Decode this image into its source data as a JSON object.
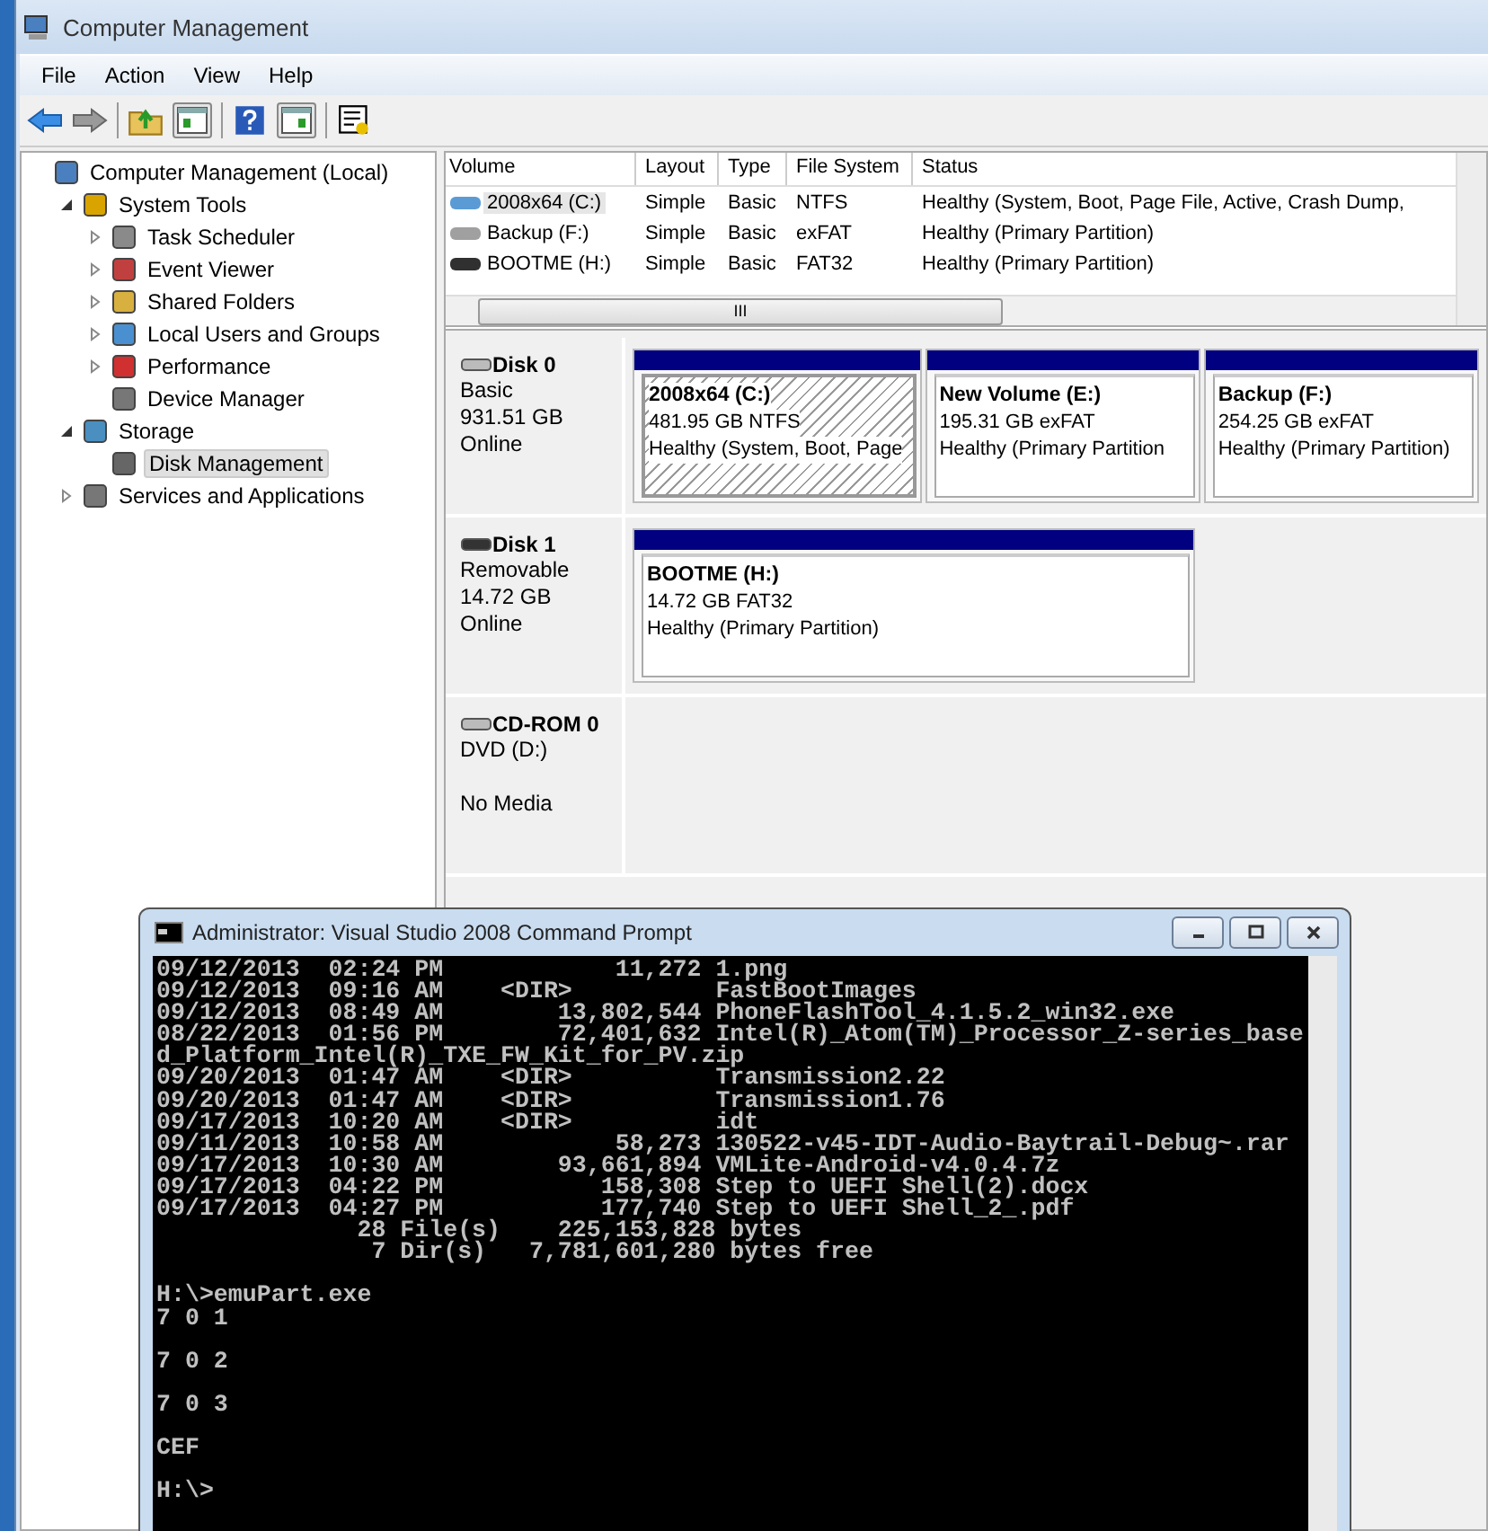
{
  "window": {
    "title": "Computer Management"
  },
  "menu": [
    "File",
    "Action",
    "View",
    "Help"
  ],
  "tree": [
    {
      "label": "Computer Management (Local)",
      "selected": false,
      "children": [
        {
          "label": "System Tools",
          "expanded": true,
          "selected": false,
          "children": [
            {
              "label": "Task Scheduler",
              "expanded": false,
              "selected": false
            },
            {
              "label": "Event Viewer",
              "expanded": false,
              "selected": false
            },
            {
              "label": "Shared Folders",
              "expanded": false,
              "selected": false
            },
            {
              "label": "Local Users and Groups",
              "expanded": false,
              "selected": false
            },
            {
              "label": "Performance",
              "expanded": false,
              "selected": false
            },
            {
              "label": "Device Manager",
              "selected": false
            }
          ]
        },
        {
          "label": "Storage",
          "expanded": true,
          "selected": false,
          "children": [
            {
              "label": "Disk Management",
              "selected": true
            }
          ]
        },
        {
          "label": "Services and Applications",
          "expanded": false,
          "selected": false
        }
      ]
    }
  ],
  "table": {
    "columns": [
      "Volume",
      "Layout",
      "Type",
      "File System",
      "Status"
    ],
    "rows": [
      {
        "volume": "2008x64 (C:)",
        "layout": "Simple",
        "type": "Basic",
        "file_system": "NTFS",
        "status": "Healthy (System, Boot, Page File, Active, Crash Dump,",
        "selected": true,
        "color": "#5b9bd5"
      },
      {
        "volume": "Backup (F:)",
        "layout": "Simple",
        "type": "Basic",
        "file_system": "exFAT",
        "status": "Healthy (Primary Partition)",
        "selected": false,
        "color": "#a0a0a0"
      },
      {
        "volume": "BOOTME (H:)",
        "layout": "Simple",
        "type": "Basic",
        "file_system": "FAT32",
        "status": "Healthy (Primary Partition)",
        "selected": false,
        "color": "#303030"
      }
    ],
    "scroll_thumb": "III"
  },
  "disks": [
    {
      "kind": "basic",
      "name": "Disk 0",
      "lines": [
        "Basic",
        "931.51 GB",
        "Online"
      ],
      "partitions": [
        {
          "name": "2008x64  (C:)",
          "size": "481.95 GB NTFS",
          "status": "Healthy (System, Boot, Page",
          "selected": true
        },
        {
          "name": "New Volume  (E:)",
          "size": "195.31 GB exFAT",
          "status": "Healthy (Primary Partition",
          "selected": false
        },
        {
          "name": "Backup  (F:)",
          "size": "254.25 GB exFAT",
          "status": "Healthy (Primary Partition)",
          "selected": false
        }
      ]
    },
    {
      "kind": "removable",
      "name": "Disk 1",
      "lines": [
        "Removable",
        "14.72 GB",
        "Online"
      ],
      "partitions": [
        {
          "name": "BOOTME  (H:)",
          "size": "14.72 GB FAT32",
          "status": "Healthy (Primary Partition)",
          "selected": false
        }
      ]
    },
    {
      "kind": "cdrom",
      "name": "CD-ROM 0",
      "lines": [
        "DVD (D:)",
        "No Media"
      ]
    }
  ],
  "console": {
    "title": "Administrator: Visual Studio 2008 Command Prompt",
    "output": "09/12/2013  02:24 PM            11,272 1.png\n09/12/2013  09:16 AM    <DIR>          FastBootImages\n09/12/2013  08:49 AM        13,802,544 PhoneFlashTool_4.1.5.2_win32.exe\n08/22/2013  01:56 PM        72,401,632 Intel(R)_Atom(TM)_Processor_Z-series_base\nd_Platform_Intel(R)_TXE_FW_Kit_for_PV.zip\n09/20/2013  01:47 AM    <DIR>          Transmission2.22\n09/20/2013  01:47 AM    <DIR>          Transmission1.76\n09/17/2013  10:20 AM    <DIR>          idt\n09/11/2013  10:58 AM            58,273 130522-v45-IDT-Audio-Baytrail-Debug~.rar\n09/17/2013  10:30 AM        93,661,894 VMLite-Android-v4.0.4.7z\n09/17/2013  04:22 PM           158,308 Step to UEFI Shell(2).docx\n09/17/2013  04:27 PM           177,740 Step to UEFI Shell_2_.pdf\n              28 File(s)    225,153,828 bytes\n               7 Dir(s)   7,781,601,280 bytes free\n\nH:\\>emuPart.exe\n7 0 1\n\n7 0 2\n\n7 0 3\n\nCEF\n\nH:\\>"
  }
}
